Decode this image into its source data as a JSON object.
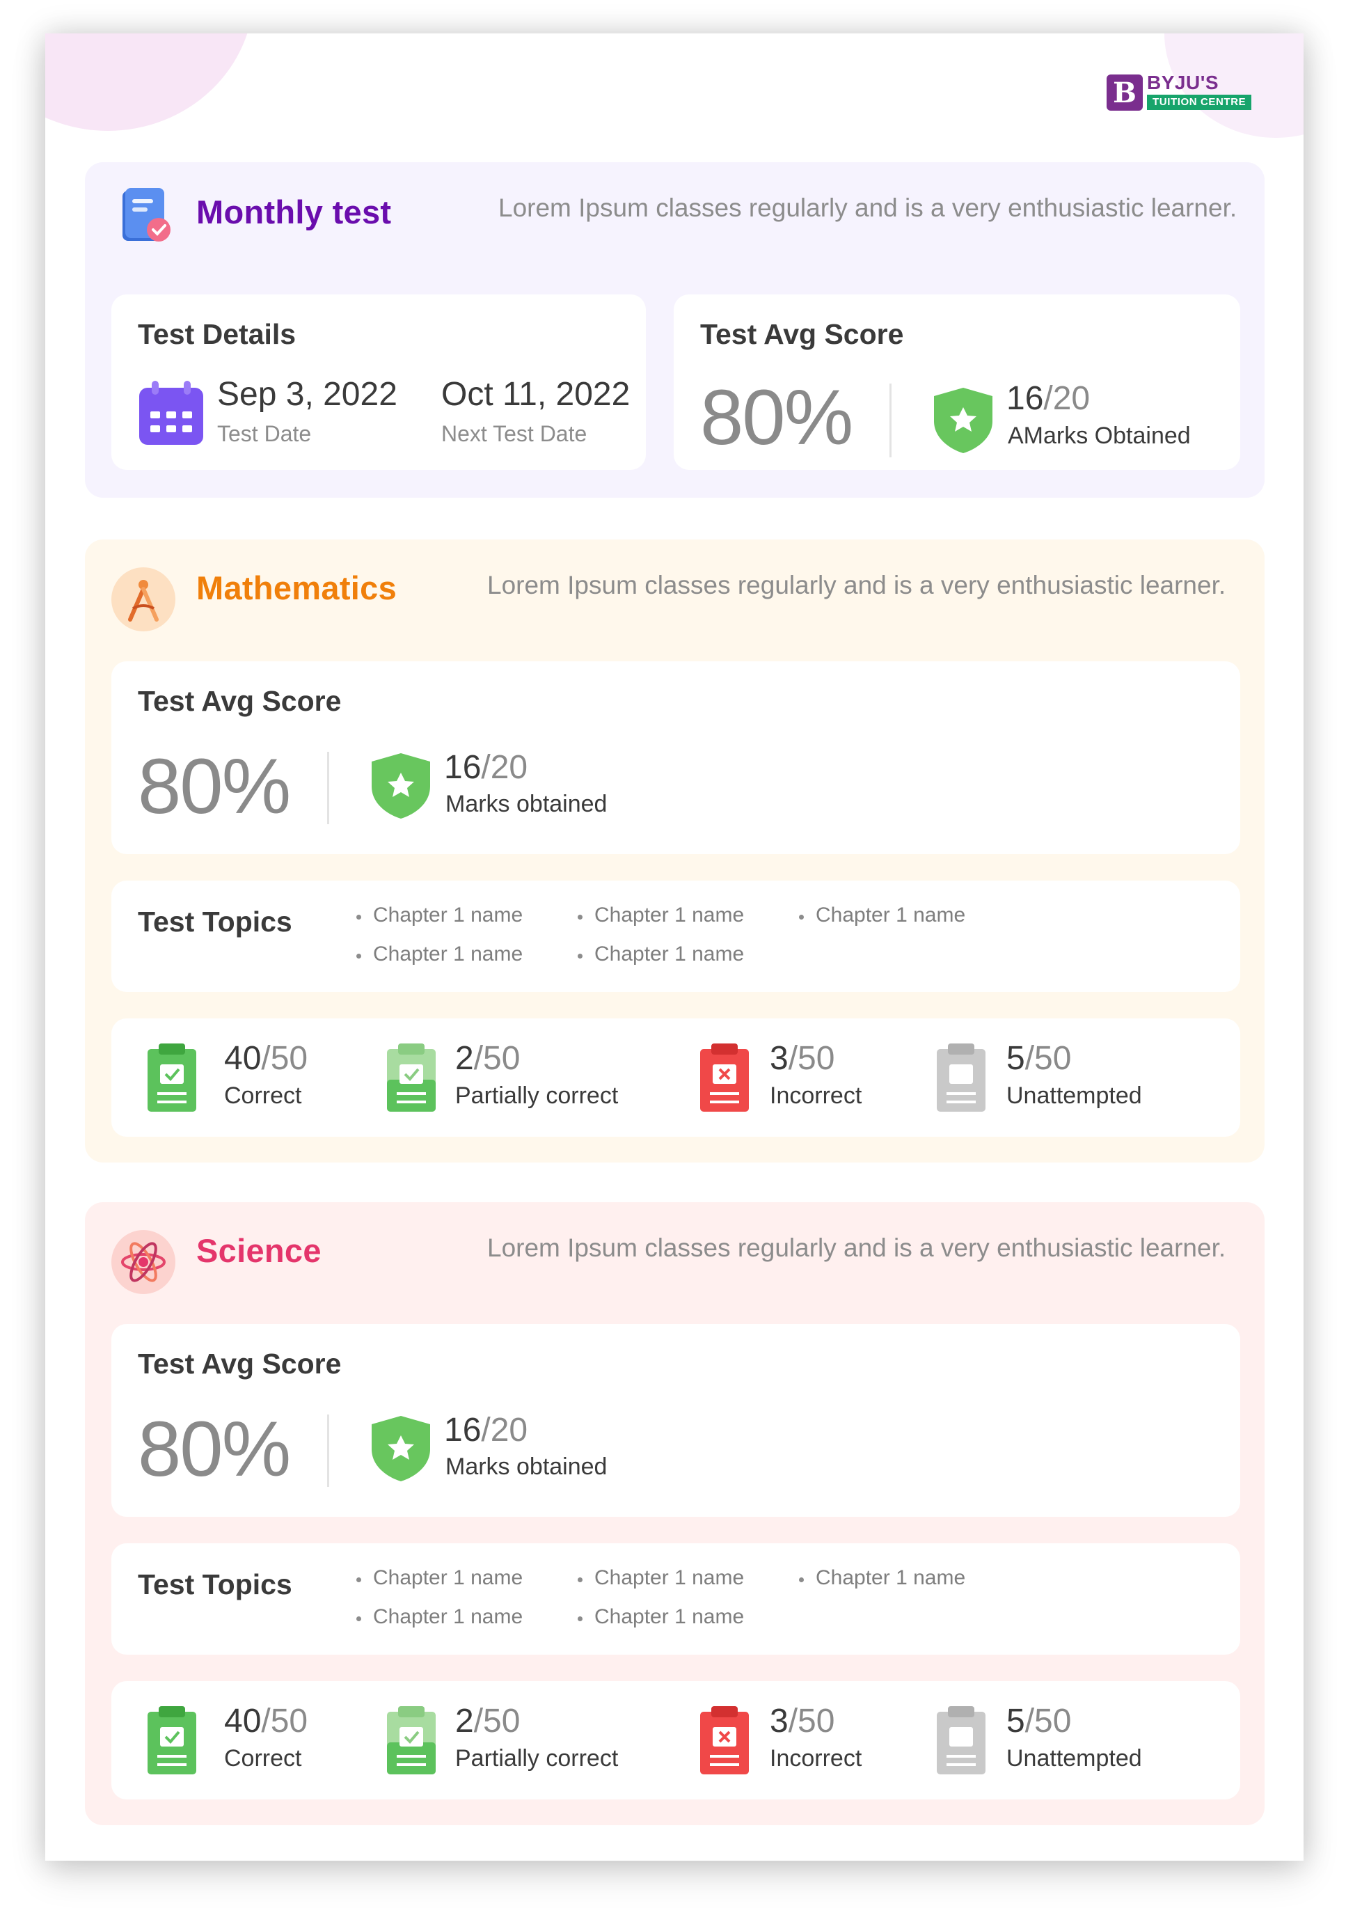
{
  "brand": {
    "name": "BYJU'S",
    "subtitle": "TUITION CENTRE",
    "letter": "B"
  },
  "monthly": {
    "title": "Monthly test",
    "description": "Lorem Ipsum classes regularly and is a very enthusiastic learner.",
    "details": {
      "title": "Test Details",
      "test_date": "Sep 3, 2022",
      "test_date_label": "Test Date",
      "next_date": "Oct 11, 2022",
      "next_date_label": "Next Test Date"
    },
    "avg": {
      "title": "Test Avg Score",
      "percent": "80%",
      "obtained": "16",
      "total": "/20",
      "label": "AMarks Obtained"
    }
  },
  "math": {
    "title": "Mathematics",
    "description": "Lorem Ipsum classes regularly and is a very enthusiastic learner.",
    "avg": {
      "title": "Test Avg Score",
      "percent": "80%",
      "obtained": "16",
      "total": "/20",
      "label": "Marks obtained"
    },
    "topics": {
      "title": "Test Topics",
      "items": [
        "Chapter 1 name",
        "Chapter 1 name",
        "Chapter 1 name",
        "Chapter 1 name",
        "Chapter 1 name"
      ]
    },
    "stats": [
      {
        "value": "40",
        "total": "/50",
        "label": "Correct"
      },
      {
        "value": "2",
        "total": "/50",
        "label": "Partially correct"
      },
      {
        "value": "3",
        "total": "/50",
        "label": "Incorrect"
      },
      {
        "value": "5",
        "total": "/50",
        "label": "Unattempted"
      }
    ]
  },
  "science": {
    "title": "Science",
    "description": "Lorem Ipsum classes regularly and is a very enthusiastic learner.",
    "avg": {
      "title": "Test Avg Score",
      "percent": "80%",
      "obtained": "16",
      "total": "/20",
      "label": "Marks obtained"
    },
    "topics": {
      "title": "Test Topics",
      "items": [
        "Chapter 1 name",
        "Chapter 1 name",
        "Chapter 1 name",
        "Chapter 1 name",
        "Chapter 1 name"
      ]
    },
    "stats": [
      {
        "value": "40",
        "total": "/50",
        "label": "Correct"
      },
      {
        "value": "2",
        "total": "/50",
        "label": "Partially correct"
      },
      {
        "value": "3",
        "total": "/50",
        "label": "Incorrect"
      },
      {
        "value": "5",
        "total": "/50",
        "label": "Unattempted"
      }
    ]
  },
  "colors": {
    "monthly_title": "#6a0dad",
    "math_title": "#f07f0a",
    "science_title": "#e4356b",
    "correct": "#5cc25c",
    "partial": "#a8dca0",
    "incorrect": "#f04848",
    "unattempted": "#c9c9c9"
  },
  "icons": {
    "monthly": "clipboard-check-icon",
    "math": "compass-icon",
    "science": "atom-icon",
    "calendar": "calendar-icon",
    "badge": "shield-star-icon"
  }
}
